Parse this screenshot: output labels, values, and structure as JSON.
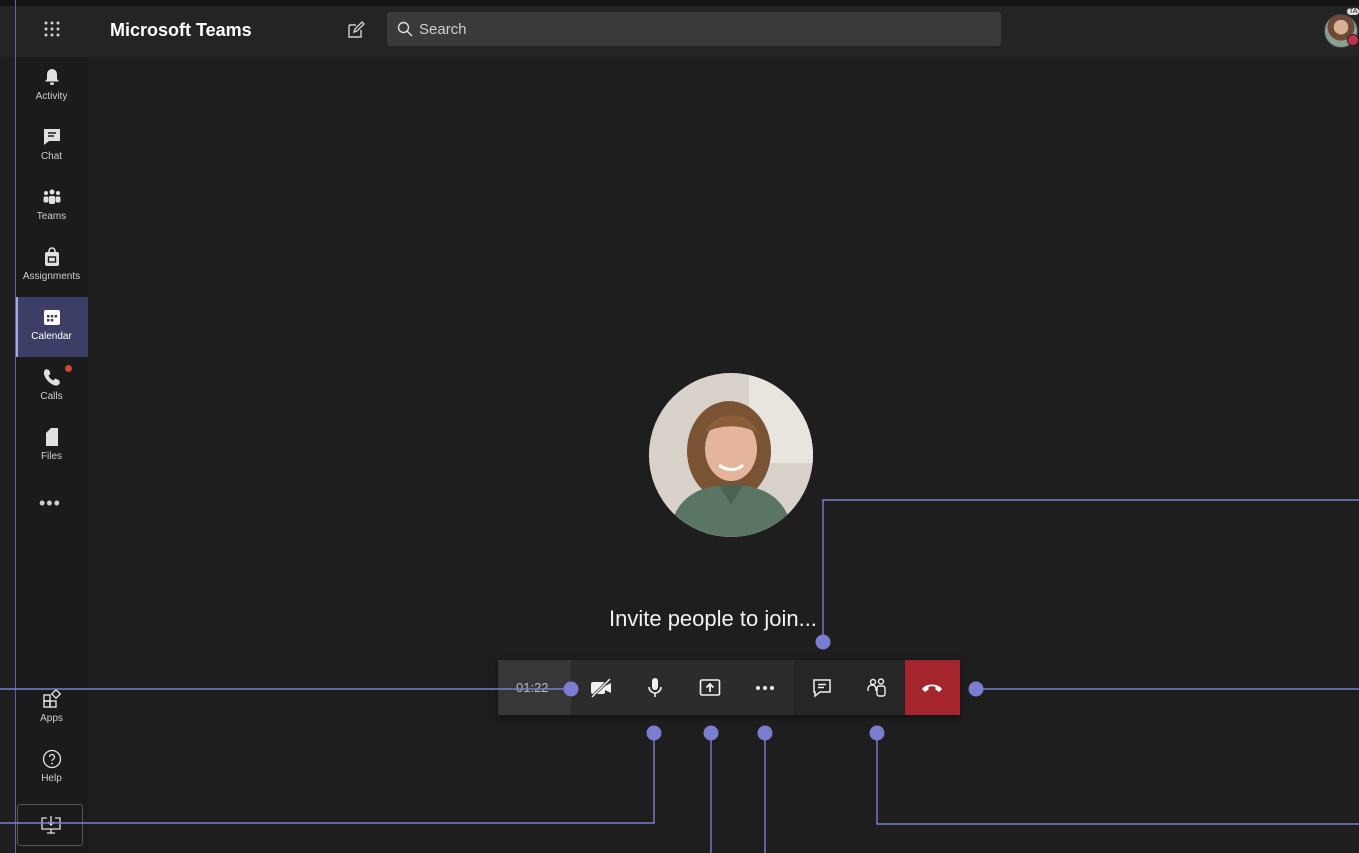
{
  "header": {
    "app_title": "Microsoft Teams",
    "search_placeholder": "Search",
    "avatar_tag": "TA"
  },
  "rail": {
    "items": [
      {
        "label": "Activity",
        "icon": "bell-icon"
      },
      {
        "label": "Chat",
        "icon": "chat-icon"
      },
      {
        "label": "Teams",
        "icon": "teams-icon"
      },
      {
        "label": "Assignments",
        "icon": "assignments-icon"
      },
      {
        "label": "Calendar",
        "icon": "calendar-icon",
        "active": true
      },
      {
        "label": "Calls",
        "icon": "phone-icon",
        "badge": true
      },
      {
        "label": "Files",
        "icon": "file-icon"
      }
    ],
    "more_label": "•••",
    "apps_label": "Apps",
    "help_label": "Help"
  },
  "call": {
    "invite_text": "Invite people to join...",
    "timer": "01:22",
    "controls": [
      "camera-off-icon",
      "microphone-icon",
      "share-screen-icon",
      "more-icon",
      "chat-icon",
      "participants-icon",
      "hang-up-icon"
    ]
  },
  "colors": {
    "accent": "#6264a7",
    "hangup": "#a4262c",
    "background": "#1f1e1f"
  }
}
